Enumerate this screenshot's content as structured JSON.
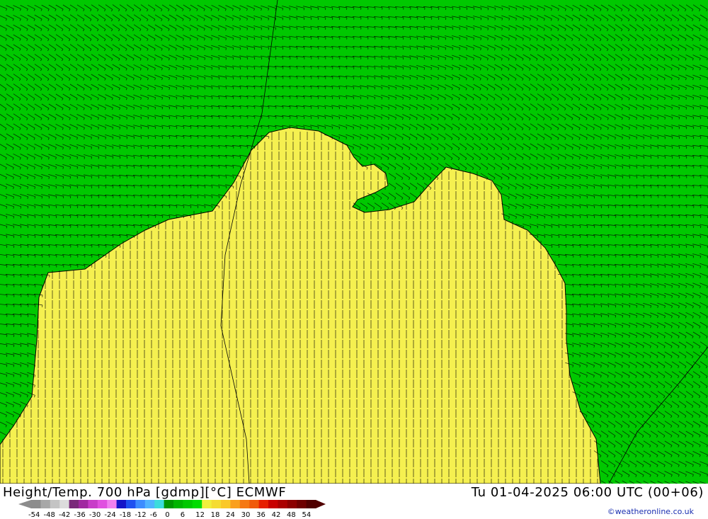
{
  "title": "Height/Temp. 700 hPa [gdmp][°C] ECMWF",
  "datetime": "Tu 01-04-2025 06:00 UTC (00+06)",
  "credit": "©weatheronline.co.uk",
  "legend": {
    "ticks": [
      "-54",
      "-48",
      "-42",
      "-36",
      "-30",
      "-24",
      "-18",
      "-12",
      "-6",
      "0",
      "6",
      "12",
      "18",
      "24",
      "30",
      "36",
      "42",
      "48",
      "54"
    ],
    "colors": [
      "#8c8c8c",
      "#a8a8a8",
      "#c4c4c4",
      "#dcdcdc",
      "#7a287a",
      "#a028a0",
      "#c83cc8",
      "#e050e0",
      "#f080f0",
      "#1414c8",
      "#1e50f0",
      "#3c8cff",
      "#50b4ff",
      "#3cdcdc",
      "#009600",
      "#00b400",
      "#00c800",
      "#00dc00",
      "#f0f03c",
      "#f5dc32",
      "#fac828",
      "#faa01e",
      "#f57814",
      "#f05a0a",
      "#e61e00",
      "#c80000",
      "#aa0000",
      "#8c0000",
      "#6e0000",
      "#500000"
    ]
  },
  "map": {
    "background_color": "#00c800",
    "warm_region_color": "#f5f050",
    "contour_color": "#000000"
  }
}
